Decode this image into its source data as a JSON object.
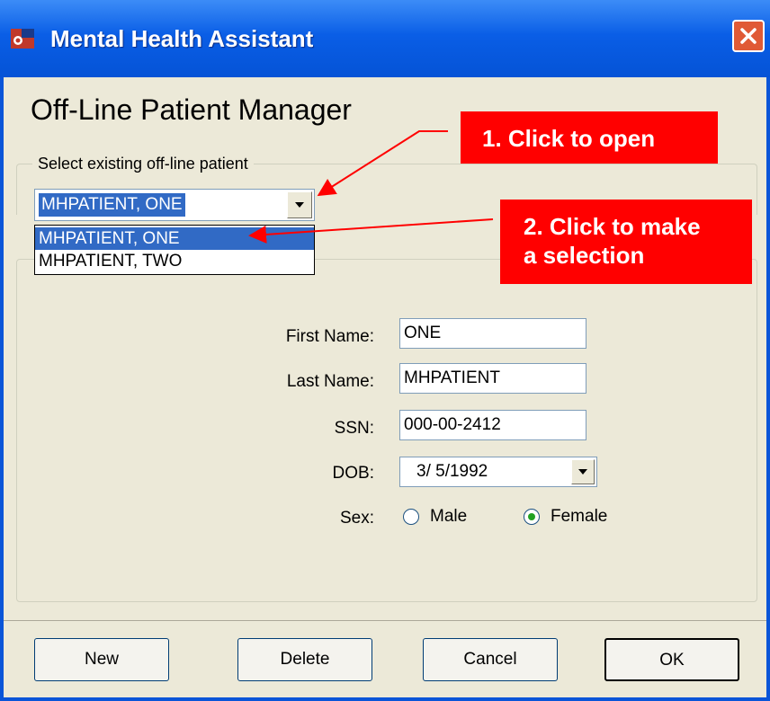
{
  "window": {
    "title": "Mental Health Assistant",
    "heading": "Off-Line Patient Manager"
  },
  "patient_select": {
    "group_label": "Select existing off-line patient",
    "selected_value": "MHPATIENT, ONE",
    "options": [
      "MHPATIENT, ONE",
      "MHPATIENT, TWO"
    ]
  },
  "form": {
    "first_name_label": "First Name:",
    "first_name_value": "ONE",
    "last_name_label": "Last Name:",
    "last_name_value": "MHPATIENT",
    "ssn_label": "SSN:",
    "ssn_value": "000-00-2412",
    "dob_label": "DOB:",
    "dob_value": "3/ 5/1992",
    "sex_label": "Sex:",
    "sex_options": [
      "Male",
      "Female"
    ],
    "sex_selected": "Female"
  },
  "buttons": {
    "new": "New",
    "delete": "Delete",
    "cancel": "Cancel",
    "ok": "OK"
  },
  "annotations": {
    "callout1": "1. Click to open",
    "callout2_line1": "2. Click to make",
    "callout2_line2": "a selection"
  },
  "colors": {
    "titlebar": "#0a5ee6",
    "selection": "#316ac5",
    "callout": "#ff0000",
    "dialog_bg": "#ece9d8"
  },
  "icons": [
    "app-icon",
    "close-icon",
    "dropdown-arrow-icon",
    "date-dropdown-icon"
  ]
}
